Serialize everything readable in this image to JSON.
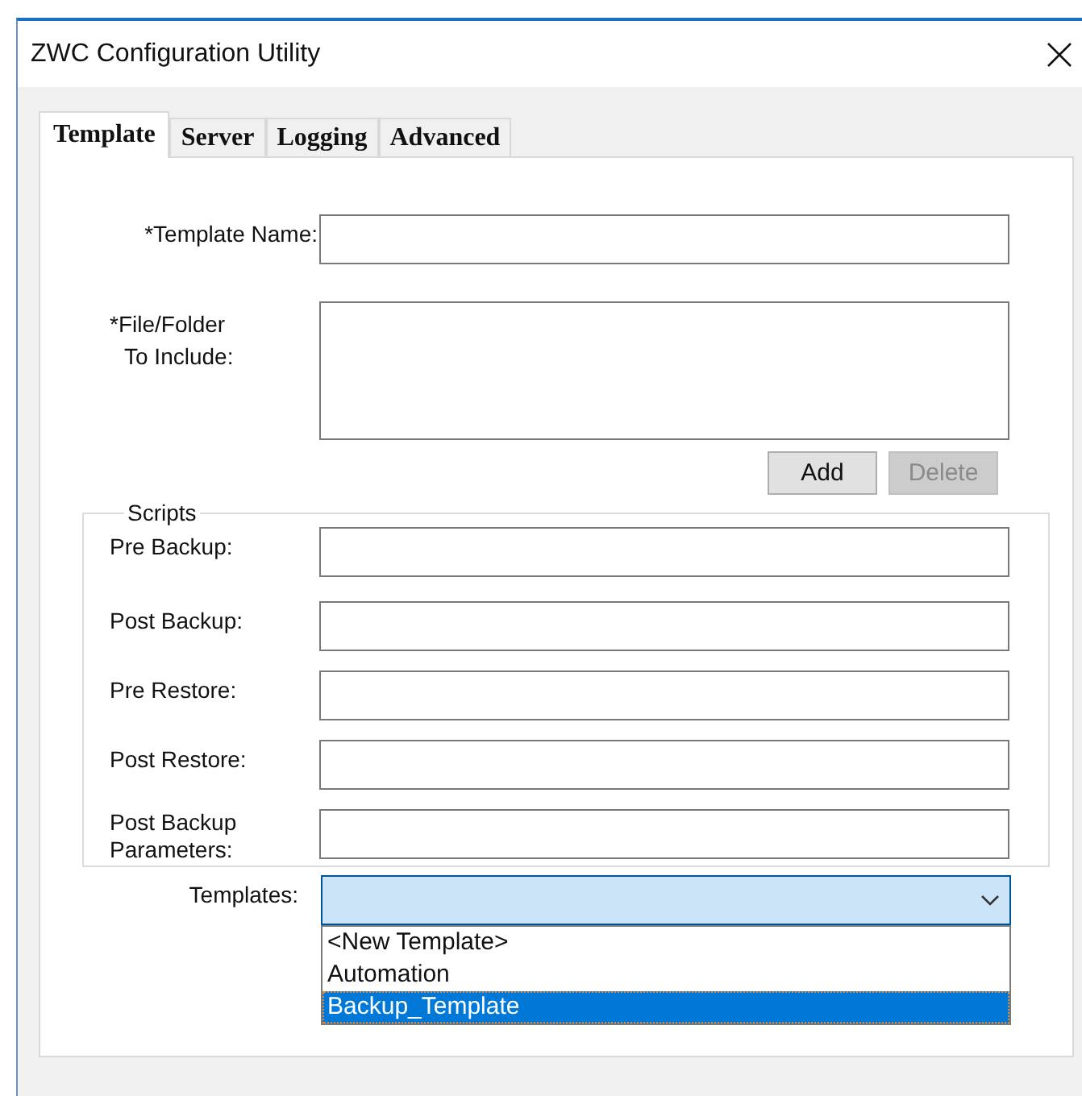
{
  "window": {
    "title": "ZWC Configuration Utility"
  },
  "tabs": [
    {
      "label": "Template",
      "selected": true
    },
    {
      "label": "Server",
      "selected": false
    },
    {
      "label": "Logging",
      "selected": false
    },
    {
      "label": "Advanced",
      "selected": false
    }
  ],
  "fields": [
    {
      "kind": "text",
      "label_lines": [
        "*Template Name:"
      ]
    },
    {
      "kind": "multiline",
      "label_lines": [
        "*File/Folder",
        "To Include:"
      ]
    }
  ],
  "buttons": [
    {
      "label": "Add",
      "disabled": false
    },
    {
      "label": "Delete",
      "disabled": true
    }
  ],
  "scripts": {
    "title": "Scripts",
    "fields": [
      {
        "label": "Pre Backup:"
      },
      {
        "label": "Post Backup:"
      },
      {
        "label": "Pre Restore:"
      },
      {
        "label": "Post Restore:"
      },
      {
        "label": "Post Backup Parameters:"
      }
    ]
  },
  "templates": {
    "label": "Templates:",
    "expanded": true,
    "options": [
      {
        "label": "<New Template>",
        "selected": false
      },
      {
        "label": "Automation",
        "selected": false
      },
      {
        "label": "Backup_Template",
        "selected": true
      }
    ]
  }
}
